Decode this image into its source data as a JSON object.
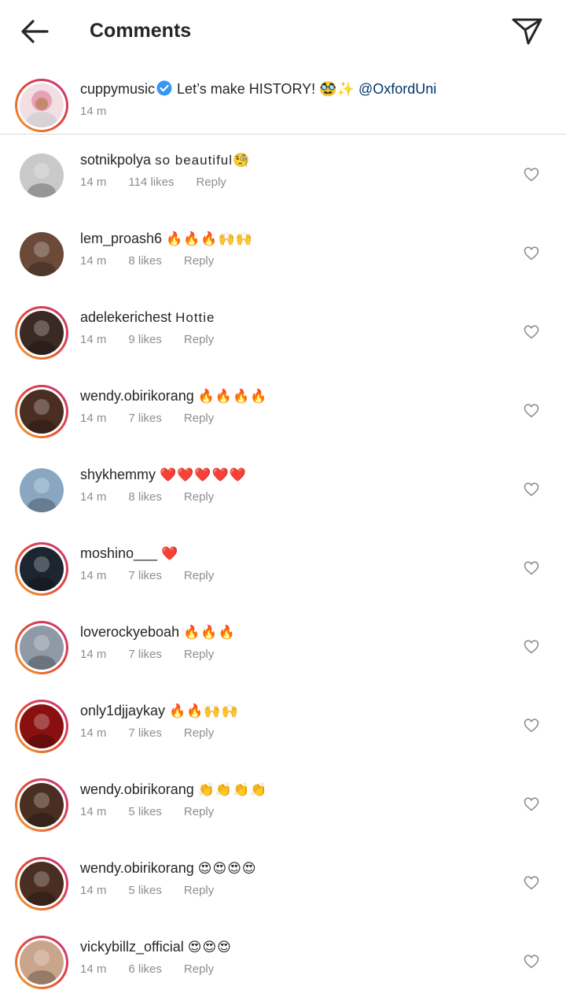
{
  "header": {
    "title": "Comments",
    "back_icon": "arrow-left-icon",
    "send_icon": "paper-plane-icon"
  },
  "caption": {
    "username": "cuppymusic",
    "text": "Let’s make HISTORY! 🥸✨",
    "mention": "@OxfordUni",
    "time": "14 m",
    "avatar_color": "#e7a8bd"
  },
  "comments": [
    {
      "username": "sotnikpolya",
      "text": "so beautiful🧐",
      "time": "14 m",
      "likes": "114 likes",
      "reply": "Reply",
      "ring": false,
      "avatar_color": "#c9c9c9"
    },
    {
      "username": "lem_proash6",
      "text": "🔥🔥🔥🙌🙌",
      "time": "14 m",
      "likes": "8 likes",
      "reply": "Reply",
      "ring": false,
      "avatar_color": "#6b4a3a"
    },
    {
      "username": "adelekerichest",
      "text": "Hottie",
      "time": "14 m",
      "likes": "9 likes",
      "reply": "Reply",
      "ring": true,
      "avatar_color": "#3b2a24"
    },
    {
      "username": "wendy.obirikorang",
      "text": "🔥🔥🔥🔥",
      "time": "14 m",
      "likes": "7 likes",
      "reply": "Reply",
      "ring": true,
      "avatar_color": "#4a2e22"
    },
    {
      "username": "shykhemmy",
      "text": "❤️❤️❤️❤️❤️",
      "time": "14 m",
      "likes": "8 likes",
      "reply": "Reply",
      "ring": false,
      "avatar_color": "#8aa7c2"
    },
    {
      "username": "moshino___",
      "text": "❤️",
      "time": "14 m",
      "likes": "7 likes",
      "reply": "Reply",
      "ring": true,
      "avatar_color": "#1d2630"
    },
    {
      "username": "loverockyeboah",
      "text": "🔥🔥🔥",
      "time": "14 m",
      "likes": "7 likes",
      "reply": "Reply",
      "ring": true,
      "avatar_color": "#8f9aa6"
    },
    {
      "username": "only1djjaykay",
      "text": "🔥🔥🙌🙌",
      "time": "14 m",
      "likes": "7 likes",
      "reply": "Reply",
      "ring": true,
      "avatar_color": "#8a1010"
    },
    {
      "username": "wendy.obirikorang",
      "text": "👏👏👏👏",
      "time": "14 m",
      "likes": "5 likes",
      "reply": "Reply",
      "ring": true,
      "avatar_color": "#4a2e22"
    },
    {
      "username": "wendy.obirikorang",
      "text": "😍😍😍😍",
      "time": "14 m",
      "likes": "5 likes",
      "reply": "Reply",
      "ring": true,
      "avatar_color": "#4a2e22"
    },
    {
      "username": "vickybillz_official",
      "text": "😍😍😍",
      "time": "14 m",
      "likes": "6 likes",
      "reply": "Reply",
      "ring": true,
      "avatar_color": "#c9a58c"
    }
  ]
}
